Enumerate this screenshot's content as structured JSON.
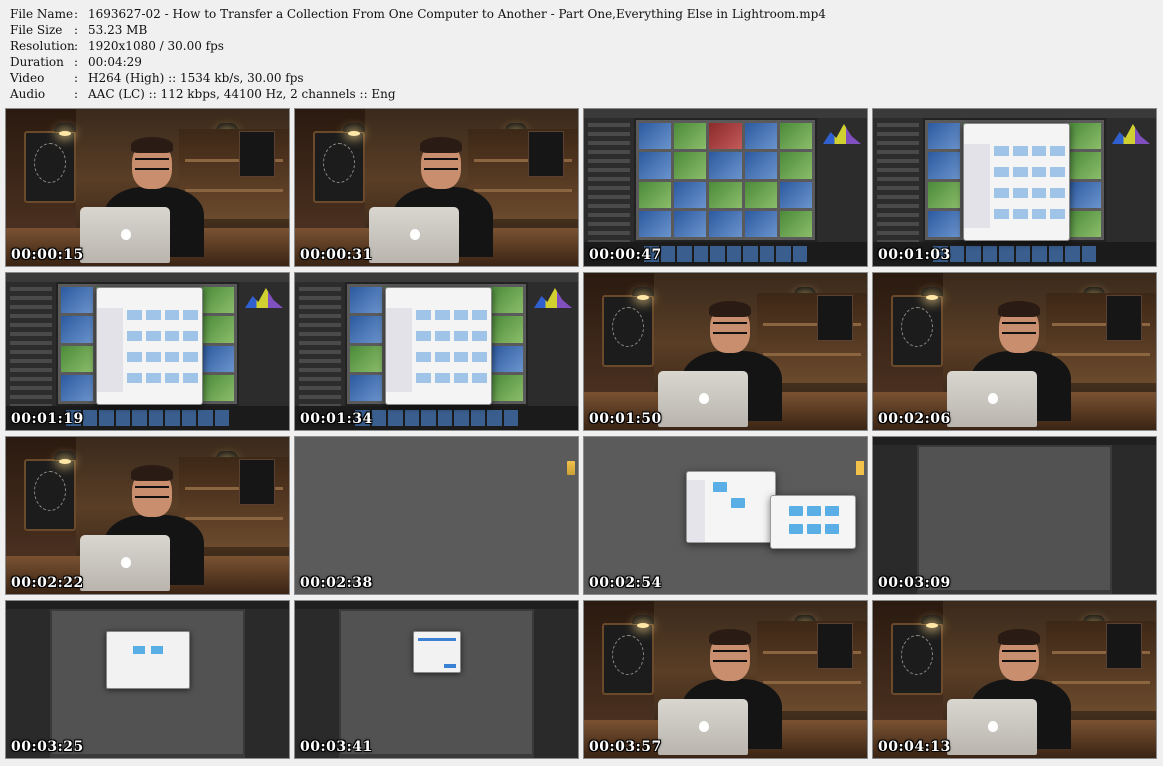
{
  "meta": [
    {
      "key": "File Name",
      "sep": ":",
      "value": "1693627-02 - How to Transfer a Collection From One Computer to Another - Part One,Everything Else in Lightroom.mp4"
    },
    {
      "key": "File Size",
      "sep": ":",
      "value": "53.23 MB"
    },
    {
      "key": "Resolution",
      "sep": ":",
      "value": "1920x1080 / 30.00 fps"
    },
    {
      "key": "Duration",
      "sep": ":",
      "value": "00:04:29"
    },
    {
      "key": "Video",
      "sep": ":",
      "value": "H264 (High) :: 1534 kb/s, 30.00 fps"
    },
    {
      "key": "Audio",
      "sep": ":",
      "value": "AAC (LC) :: 112 kbps, 44100 Hz, 2 channels :: Eng"
    }
  ],
  "thumbnails": [
    {
      "time": "00:00:15",
      "scene": "presenter"
    },
    {
      "time": "00:00:31",
      "scene": "presenter"
    },
    {
      "time": "00:00:47",
      "scene": "lightroom-grid"
    },
    {
      "time": "00:01:03",
      "scene": "lightroom-dialog"
    },
    {
      "time": "00:01:19",
      "scene": "lightroom-dialog"
    },
    {
      "time": "00:01:34",
      "scene": "lightroom-dialog"
    },
    {
      "time": "00:01:50",
      "scene": "presenter"
    },
    {
      "time": "00:02:06",
      "scene": "presenter"
    },
    {
      "time": "00:02:22",
      "scene": "presenter"
    },
    {
      "time": "00:02:38",
      "scene": "empty-grey"
    },
    {
      "time": "00:02:54",
      "scene": "finder-windows"
    },
    {
      "time": "00:03:09",
      "scene": "lightroom-dark"
    },
    {
      "time": "00:03:25",
      "scene": "lightroom-dark-dialog"
    },
    {
      "time": "00:03:41",
      "scene": "lightroom-dark-small-dialog"
    },
    {
      "time": "00:03:57",
      "scene": "presenter"
    },
    {
      "time": "00:04:13",
      "scene": "presenter"
    }
  ]
}
